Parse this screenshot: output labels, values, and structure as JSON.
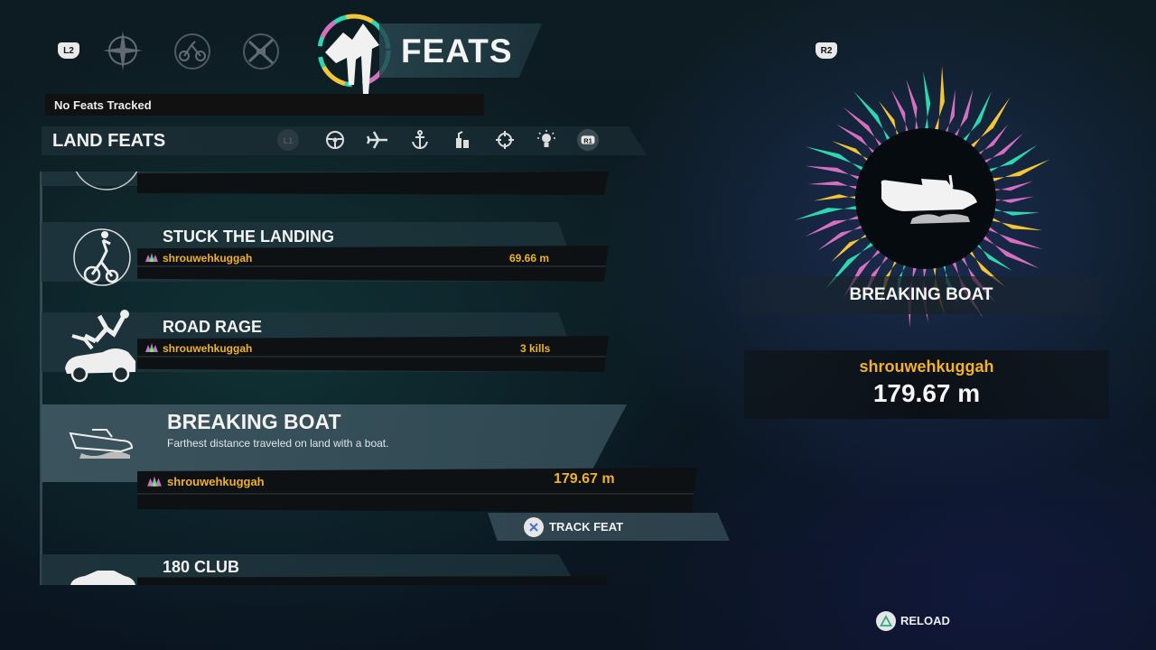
{
  "nav": {
    "left_trigger": "L2",
    "right_trigger": "R2",
    "title": "FEATS",
    "tab_icons": [
      "compass-icon",
      "bike-tab-icon",
      "weapons-tab-icon"
    ]
  },
  "tracked": {
    "label": "No Feats Tracked"
  },
  "category": {
    "title": "LAND FEATS",
    "left_bumper": "L1",
    "right_bumper": "R1",
    "icons": [
      "steering-wheel-icon",
      "plane-icon",
      "anchor-icon",
      "explosive-icon",
      "crosshair-icon",
      "lightbulb-icon"
    ]
  },
  "feats": [
    {
      "title": "STUCK THE LANDING",
      "player": "shrouwehkuggah",
      "value": "69.66 m"
    },
    {
      "title": "ROAD RAGE",
      "player": "shrouwehkuggah",
      "value": "3 kills"
    },
    {
      "title": "BREAKING BOAT",
      "description": "Farthest distance traveled on land with a boat.",
      "player": "shrouwehkuggah",
      "value": "179.67 m",
      "selected": true
    },
    {
      "title": "180 CLUB"
    }
  ],
  "track_button": {
    "label": "TRACK FEAT"
  },
  "detail": {
    "name": "BREAKING BOAT",
    "player": "shrouwehkuggah",
    "value": "179.67 m"
  },
  "reload": {
    "label": "RELOAD"
  },
  "colors": {
    "accent_gold": "#f1b12a",
    "burst_pink": "#d66fc0",
    "burst_teal": "#2fd7b0",
    "burst_yellow": "#f4c536"
  }
}
